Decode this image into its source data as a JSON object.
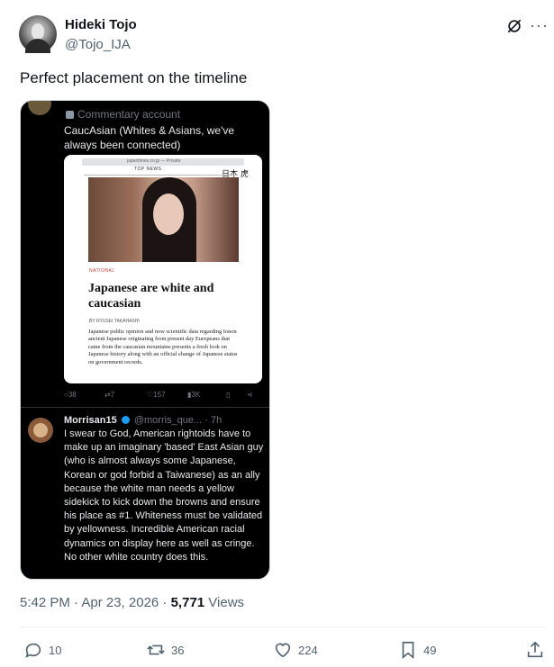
{
  "author": {
    "display_name": "Hideki Tojo",
    "handle": "@Tojo_IJA"
  },
  "tweet_text": "Perfect placement on the timeline",
  "media": {
    "community_label": "Commentary account",
    "caption": "CaucAsian (Whites & Asians, we've always been connected)",
    "article": {
      "url": "japantimes.co.jp — Private",
      "top_news": "TOP NEWS",
      "brand": "日本 虎",
      "section": "NATIONAL",
      "title": "Japanese are white and caucasian",
      "byline": "BY RYUSEI TAKAHASHI",
      "body": "Japanese public opinion and now scientific data regarding Ionon ancient Japanese originating from present day Europeans that came from the caucasian mountains presents a fresh look on Japanese history along with an official change of Japanese status on government records."
    },
    "actions": {
      "replies": "38",
      "retweets": "7",
      "likes": "157",
      "views": "3K"
    },
    "reply": {
      "name": "Morrisan15",
      "handle_time": "@morris_que... · 7h",
      "text": "I swear to God, American rightoids have to make up an imaginary 'based' East Asian guy (who is almost always some Japanese, Korean or god forbid a Taiwanese) as an ally because the white man needs a yellow sidekick to kick down the browns and ensure his place as #1. Whiteness must be validated by yellowness. Incredible American racial dynamics on display here as well as cringe. No other white country does this."
    }
  },
  "meta": {
    "time": "5:42 PM · Apr 23, 2026 · ",
    "views_count": "5,771",
    "views_label": " Views"
  },
  "stats": {
    "replies": "10",
    "retweets": "36",
    "likes": "224",
    "bookmarks": "49"
  },
  "icons": [
    "grok-icon",
    "more-icon",
    "reply-icon",
    "retweet-icon",
    "like-icon",
    "bookmark-icon",
    "share-icon"
  ]
}
